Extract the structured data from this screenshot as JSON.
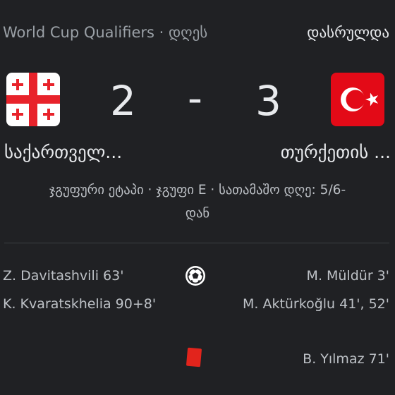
{
  "header": {
    "competition": "World Cup Qualifiers · დღეს",
    "status": "დასრულდა"
  },
  "match": {
    "home": {
      "name": "საქართველ...",
      "score": "2",
      "flag_icon": "georgia-flag-icon"
    },
    "separator": "-",
    "away": {
      "name": "თურქეთის ...",
      "score": "3",
      "flag_icon": "turkey-flag-icon"
    },
    "stage_line1": "ჯგუფური ეტაპი · ჯგუფი E · სათამაშო დღე: 5/6-",
    "stage_line2": "დან"
  },
  "events": {
    "goals_icon": "soccer-ball-icon",
    "home_goals": [
      "Z. Davitashvili 63'",
      "K. Kvaratskhelia 90+8'"
    ],
    "away_goals": [
      "M. Müldür 3'",
      "M. Aktürkoğlu 41', 52'"
    ],
    "red_card_icon": "red-card-icon",
    "away_red_cards": [
      "B. Yılmaz 71'"
    ]
  },
  "colors": {
    "background": "#202124",
    "georgia_red": "#e8232b",
    "turkey_red": "#e30a17",
    "red_card": "#e2241c"
  }
}
